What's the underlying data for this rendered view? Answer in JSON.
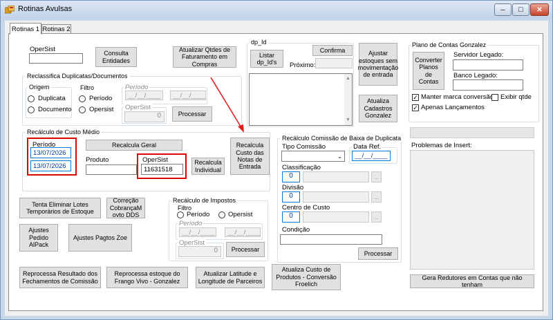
{
  "window": {
    "title": "Rotinas Avulsas",
    "minimize": "─",
    "maximize": "□",
    "close": "✕"
  },
  "tabs": [
    {
      "label": "Rotinas 1"
    },
    {
      "label": "Rotinas 2"
    }
  ],
  "top": {
    "opersist_label": "OperSist",
    "consulta_entidades": "Consulta Entidades",
    "atualizar_qtdes": "Atualizar Qtdes de Faturamento em Compras"
  },
  "reclassifica": {
    "title": "Reclassifica Duplicatas/Documentos",
    "origem_title": "Origem",
    "origem_duplicata": "Duplicata",
    "origem_documento": "Documento",
    "filtro_title": "Filtro",
    "filtro_periodo": "Período",
    "filtro_opersist": "Opersist",
    "periodo_label": "Período",
    "date_placeholder": "__/__/____",
    "opersist_label": "OperSist",
    "opersist_value": "0",
    "processar": "Processar"
  },
  "recalculo_custo": {
    "title": "Recálculo de Custo Médio",
    "periodo_label": "Período",
    "date_from": "13/07/2026",
    "date_to": "13/07/2026",
    "recalcula_geral": "Recalcula Geral",
    "produto_label": "Produto",
    "opersist_label": "OperSist",
    "opersist_value": "11631518",
    "recalcula_individual": "Recalcula Individual",
    "recalcula_custo_notas": "Recalcula Custo das Notas de Entrada"
  },
  "dp_id": {
    "title": "dp_Id",
    "listar": "Listar dp_Id's",
    "confirma": "Confirma",
    "proximo_label": "Próximo:"
  },
  "side_buttons": {
    "ajustar_estoques": "Ajustar estoques sem movimentação de entrada",
    "atualiza_cadastros": "Atualiza Cadastros Gonzalez"
  },
  "plano_contas": {
    "title": "Plano de Contas Gonzalez",
    "converter": "Converter Planos de Contas",
    "servidor_label": "Servidor Legado:",
    "banco_label": "Banco Legado:",
    "manter_marca": "Manter marca conversão",
    "exibir_qtde": "Exibir qtde",
    "apenas_lancamentos": "Apenas Lançamentos",
    "problemas_label": "Problemas de Insert:",
    "gera_redutores": "Gera Redutores em Contas que não tenham"
  },
  "recalculo_comissao": {
    "title": "Recálculo Comissão de Baixa de Duplicata",
    "tipo_comissao_label": "Tipo Comissão",
    "data_ref_label": "Data Ref.",
    "date_placeholder": "__/__/____",
    "classificacao_label": "Classificação",
    "divisao_label": "Divisão",
    "centro_custo_label": "Centro de Custo",
    "condicao_label": "Condição",
    "zero": "0",
    "ellipsis": "...",
    "processar": "Processar"
  },
  "left_buttons": {
    "tenta_eliminar": "Tenta Eliminar Lotes Temporários de Estoque",
    "correcao_cobranca": "Correção CobrançaM ovto DDS",
    "ajustes_pedido": "Ajustes Pedido AlPack",
    "ajustes_pagtos": "Ajustes Pagtos Zoe"
  },
  "recalculo_impostos": {
    "title": "Recálculo de Impostos",
    "filtro_label": "Filtro",
    "periodo_option": "Período",
    "opersist_option": "Opersist",
    "periodo_label": "Período",
    "date_placeholder": "__/__/____",
    "opersist_label": "OperSist",
    "opersist_value": "0",
    "processar": "Processar"
  },
  "bottom_buttons": {
    "reprocessa_resultado": "Reprocessa Resultado dos Fechamentos de Comissão",
    "reprocessa_estoque": "Reprocessa estoque do Frango Vivo - Gonzalez",
    "atualizar_latitude": "Atualizar Latitude e Longitude de Parceiros",
    "atualiza_custo": "Atualiza Custo de Produtos - Conversão Froelich"
  },
  "colors": {
    "highlight_red": "#e00000",
    "arrow_red": "#e02020",
    "accent_blue": "#0078d7"
  }
}
